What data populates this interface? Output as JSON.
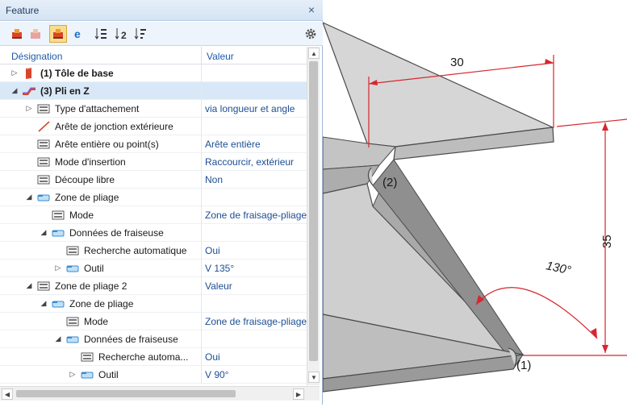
{
  "panel": {
    "title": "Feature",
    "close_glyph": "×",
    "toolbar": [
      {
        "icon": "feature-red-icon"
      },
      {
        "icon": "feature-gray-icon"
      },
      {
        "icon": "feature-active-icon",
        "active": true
      },
      {
        "icon": "edge-e-icon"
      },
      {
        "icon": "sort-tree-icon"
      },
      {
        "icon": "sort-2-icon"
      },
      {
        "icon": "sort-3-icon"
      },
      {
        "icon": "gear-icon"
      }
    ],
    "columns": {
      "name": "Désignation",
      "value": "Valeur"
    },
    "rows": [
      {
        "expander": "▷",
        "indent": 0,
        "icon": "sheet-red-icon",
        "label": "(1) Tôle de base",
        "value": "",
        "bold": true
      },
      {
        "expander": "◢",
        "indent": 0,
        "icon": "zbend-icon",
        "label": "(3) Pli en Z",
        "value": "",
        "bold": true,
        "selected": true
      },
      {
        "expander": "▷",
        "indent": 1,
        "icon": "param-icon",
        "label": "Type d'attachement",
        "value": "via longueur et angle"
      },
      {
        "expander": "",
        "indent": 1,
        "icon": "edge-line-icon",
        "label": "Arête de jonction extérieure",
        "value": ""
      },
      {
        "expander": "",
        "indent": 1,
        "icon": "param-icon",
        "label": "Arête entière ou point(s)",
        "value": "Arête entière"
      },
      {
        "expander": "",
        "indent": 1,
        "icon": "param-icon",
        "label": "Mode d'insertion",
        "value": "Raccourcir, extérieur"
      },
      {
        "expander": "",
        "indent": 1,
        "icon": "param-icon",
        "label": "Découpe libre",
        "value": "Non"
      },
      {
        "expander": "◢",
        "indent": 1,
        "icon": "folder-icon",
        "label": "Zone de pliage",
        "value": ""
      },
      {
        "expander": "",
        "indent": 2,
        "icon": "param-icon",
        "label": "Mode",
        "value": "Zone de fraisage-pliage"
      },
      {
        "expander": "◢",
        "indent": 2,
        "icon": "folder-icon",
        "label": "Données de fraiseuse",
        "value": ""
      },
      {
        "expander": "",
        "indent": 3,
        "icon": "param-icon",
        "label": "Recherche automatique",
        "value": "Oui"
      },
      {
        "expander": "▷",
        "indent": 3,
        "icon": "folder-icon",
        "label": "Outil",
        "value": "V 135°"
      },
      {
        "expander": "◢",
        "indent": 1,
        "icon": "param-icon",
        "label": "Zone de pliage 2",
        "value": "Valeur"
      },
      {
        "expander": "◢",
        "indent": 2,
        "icon": "folder-icon",
        "label": "Zone de pliage",
        "value": ""
      },
      {
        "expander": "",
        "indent": 3,
        "icon": "param-icon",
        "label": "Mode",
        "value": "Zone de fraisage-pliage"
      },
      {
        "expander": "◢",
        "indent": 3,
        "icon": "folder-icon",
        "label": "Données de fraiseuse",
        "value": ""
      },
      {
        "expander": "",
        "indent": 4,
        "icon": "param-icon",
        "label": "Recherche automa...",
        "value": "Oui"
      },
      {
        "expander": "▷",
        "indent": 4,
        "icon": "folder-icon",
        "label": "Outil",
        "value": "V 90°"
      }
    ],
    "scroll_glyphs": {
      "up": "▲",
      "down": "▼",
      "left": "◀",
      "right": "▶"
    }
  },
  "viewport": {
    "dimensions": {
      "top_length": "30",
      "height": "35",
      "angle": "130°"
    },
    "labels": {
      "bend1": "(1)",
      "bend2": "(2)"
    },
    "colors": {
      "dimension": "#d8262e",
      "face_light": "#d4d4d4",
      "face_mid": "#bdbdbd",
      "face_dark": "#9a9a9a",
      "edge": "#4a4a4a"
    }
  }
}
